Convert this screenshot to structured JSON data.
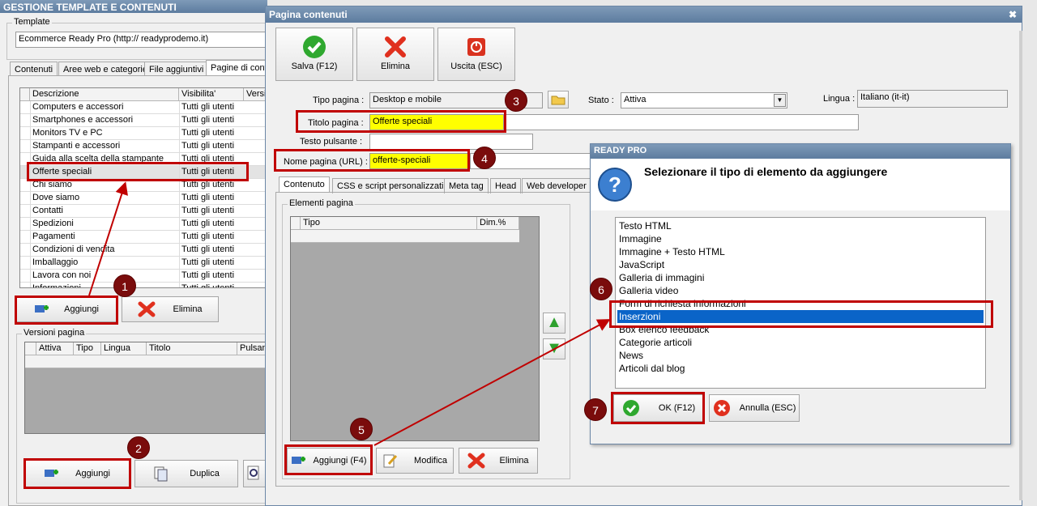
{
  "main": {
    "title": "GESTIONE TEMPLATE E CONTENUTI",
    "template_label": "Template",
    "template_value": "Ecommerce Ready Pro (http://        readyprodemo.it)",
    "tabs": [
      "Contenuti",
      "Aree web e categorie",
      "File aggiuntivi",
      "Pagine di conte"
    ],
    "pages_headers": [
      "Descrizione",
      "Visibilita'",
      "Versi"
    ],
    "pages": [
      [
        "Computers e accessori",
        "Tutti gli utenti"
      ],
      [
        "Smartphones e accessori",
        "Tutti gli utenti"
      ],
      [
        "Monitors TV e PC",
        "Tutti gli utenti"
      ],
      [
        "Stampanti e accessori",
        "Tutti gli utenti"
      ],
      [
        "Guida alla scelta della stampante",
        "Tutti gli utenti"
      ],
      [
        "Offerte speciali",
        "Tutti gli utenti"
      ],
      [
        "Chi siamo",
        "Tutti gli utenti"
      ],
      [
        "Dove siamo",
        "Tutti gli utenti"
      ],
      [
        "Contatti",
        "Tutti gli utenti"
      ],
      [
        "Spedizioni",
        "Tutti gli utenti"
      ],
      [
        "Pagamenti",
        "Tutti gli utenti"
      ],
      [
        "Condizioni di vendita",
        "Tutti gli utenti"
      ],
      [
        "Imballaggio",
        "Tutti gli utenti"
      ],
      [
        "Lavora con noi",
        "Tutti gli utenti"
      ],
      [
        "Informazioni",
        "Tutti gli utenti"
      ]
    ],
    "add": "Aggiungi",
    "delete": "Elimina",
    "versions_label": "Versioni pagina",
    "versions_headers": [
      "Attiva",
      "Tipo",
      "Lingua",
      "Titolo",
      "Pulsan"
    ],
    "add2": "Aggiungi",
    "duplicate": "Duplica"
  },
  "dialog": {
    "title": "Pagina contenuti",
    "save": "Salva (F12)",
    "delete": "Elimina",
    "exit": "Uscita (ESC)",
    "tipo_label": "Tipo pagina :",
    "tipo_value": "Desktop e mobile",
    "stato_label": "Stato :",
    "stato_value": "Attiva",
    "lingua_label": "Lingua :",
    "lingua_value": "Italiano (it-it)",
    "titolo_label": "Titolo pagina :",
    "titolo_value": "Offerte speciali",
    "testo_label": "Testo pulsante :",
    "testo_value": "",
    "nome_label": "Nome pagina (URL) :",
    "nome_value": "offerte-speciali",
    "tabs": [
      "Contenuto",
      "CSS e script personalizzati",
      "Meta tag",
      "Head",
      "Web developer"
    ],
    "elements_label": "Elementi pagina",
    "el_headers": [
      "Tipo",
      "Dim.%"
    ],
    "add": "Aggiungi (F4)",
    "edit": "Modifica"
  },
  "popup": {
    "title": "READY PRO",
    "question": "Selezionare il tipo di elemento da aggiungere",
    "items": [
      "Testo HTML",
      "Immagine",
      "Immagine + Testo HTML",
      "JavaScript",
      "Galleria di immagini",
      "Galleria video",
      "Form di richiesta informazioni",
      "Inserzioni",
      "Box elenco feedback",
      "Categorie articoli",
      "News",
      "Articoli dal blog"
    ],
    "selected": "Inserzioni",
    "ok": "OK (F12)",
    "cancel": "Annulla (ESC)"
  },
  "steps": [
    "1",
    "2",
    "3",
    "4",
    "5",
    "6",
    "7"
  ]
}
